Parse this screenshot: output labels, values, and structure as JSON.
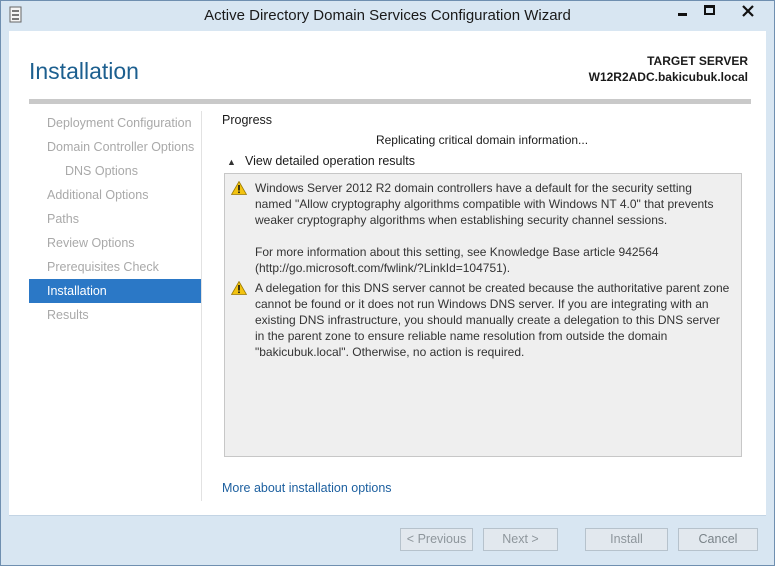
{
  "window": {
    "title": "Active Directory Domain Services Configuration Wizard",
    "controls": {
      "minimize": "minimize-icon",
      "maximize": "maximize-icon",
      "close": "close-icon"
    }
  },
  "header": {
    "page_title": "Installation",
    "target_server_label": "TARGET SERVER",
    "target_server_name": "W12R2ADC.bakicubuk.local"
  },
  "nav": {
    "items": [
      {
        "label": "Deployment Configuration",
        "sub": false,
        "active": false
      },
      {
        "label": "Domain Controller Options",
        "sub": false,
        "active": false
      },
      {
        "label": "DNS Options",
        "sub": true,
        "active": false
      },
      {
        "label": "Additional Options",
        "sub": false,
        "active": false
      },
      {
        "label": "Paths",
        "sub": false,
        "active": false
      },
      {
        "label": "Review Options",
        "sub": false,
        "active": false
      },
      {
        "label": "Prerequisites Check",
        "sub": false,
        "active": false
      },
      {
        "label": "Installation",
        "sub": false,
        "active": true
      },
      {
        "label": "Results",
        "sub": false,
        "active": false
      }
    ]
  },
  "main": {
    "progress_label": "Progress",
    "status_text": "Replicating critical domain information...",
    "details_toggle_label": "View detailed operation results",
    "messages": [
      {
        "icon": "warning-icon",
        "paragraphs": [
          "Windows Server 2012 R2 domain controllers have a default for the security setting named \"Allow cryptography algorithms compatible with Windows NT 4.0\" that prevents weaker cryptography algorithms when establishing security channel sessions.",
          "For more information about this setting, see Knowledge Base article 942564 (http://go.microsoft.com/fwlink/?LinkId=104751)."
        ]
      },
      {
        "icon": "warning-icon",
        "paragraphs": [
          "A delegation for this DNS server cannot be created because the authoritative parent zone cannot be found or it does not run Windows DNS server. If you are integrating with an existing DNS infrastructure, you should manually create a delegation to this DNS server in the parent zone to ensure reliable name resolution from outside the domain \"bakicubuk.local\". Otherwise, no action is required."
        ]
      }
    ],
    "more_link": "More about installation options"
  },
  "footer": {
    "previous": "< Previous",
    "next": "Next >",
    "install": "Install",
    "cancel": "Cancel"
  },
  "colors": {
    "accent": "#2b78c6",
    "title_blue": "#1c5f8f",
    "link": "#1c5f9f",
    "chrome": "#d8e6f2"
  }
}
